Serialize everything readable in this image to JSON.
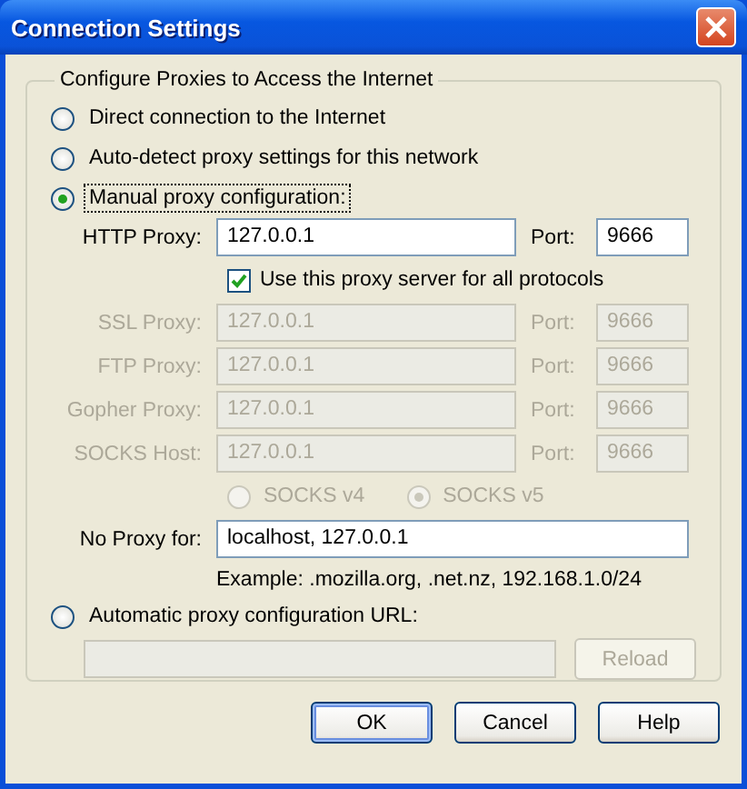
{
  "window": {
    "title": "Connection Settings"
  },
  "group": {
    "title": "Configure Proxies to Access the Internet"
  },
  "modes": [
    {
      "label": "Direct connection to the Internet",
      "selected": false,
      "focused": false
    },
    {
      "label": "Auto-detect proxy settings for this network",
      "selected": false,
      "focused": false
    },
    {
      "label": "Manual proxy configuration:",
      "selected": true,
      "focused": true
    }
  ],
  "manual": {
    "http": {
      "label": "HTTP Proxy:",
      "value": "127.0.0.1",
      "port_label": "Port:",
      "port": "9666",
      "disabled": false
    },
    "share_all": {
      "label": "Use this proxy server for all protocols",
      "checked": true
    },
    "proxies": [
      {
        "label": "SSL Proxy:",
        "value": "127.0.0.1",
        "port_label": "Port:",
        "port": "9666",
        "disabled": true
      },
      {
        "label": "FTP Proxy:",
        "value": "127.0.0.1",
        "port_label": "Port:",
        "port": "9666",
        "disabled": true
      },
      {
        "label": "Gopher Proxy:",
        "value": "127.0.0.1",
        "port_label": "Port:",
        "port": "9666",
        "disabled": true
      },
      {
        "label": "SOCKS Host:",
        "value": "127.0.0.1",
        "port_label": "Port:",
        "port": "9666",
        "disabled": true
      }
    ],
    "socks_versions": [
      {
        "label": "SOCKS v4",
        "selected": false,
        "disabled": true
      },
      {
        "label": "SOCKS v5",
        "selected": true,
        "disabled": true
      }
    ],
    "no_proxy": {
      "label": "No Proxy for:",
      "value": "localhost, 127.0.0.1"
    },
    "example": "Example: .mozilla.org, .net.nz, 192.168.1.0/24"
  },
  "auto_config": {
    "label": "Automatic proxy configuration URL:",
    "selected": false,
    "url_disabled": true,
    "reload": {
      "label": "Reload",
      "disabled": true
    }
  },
  "buttons": [
    {
      "label": "OK",
      "default": true
    },
    {
      "label": "Cancel",
      "default": false
    },
    {
      "label": "Help",
      "default": false
    }
  ]
}
